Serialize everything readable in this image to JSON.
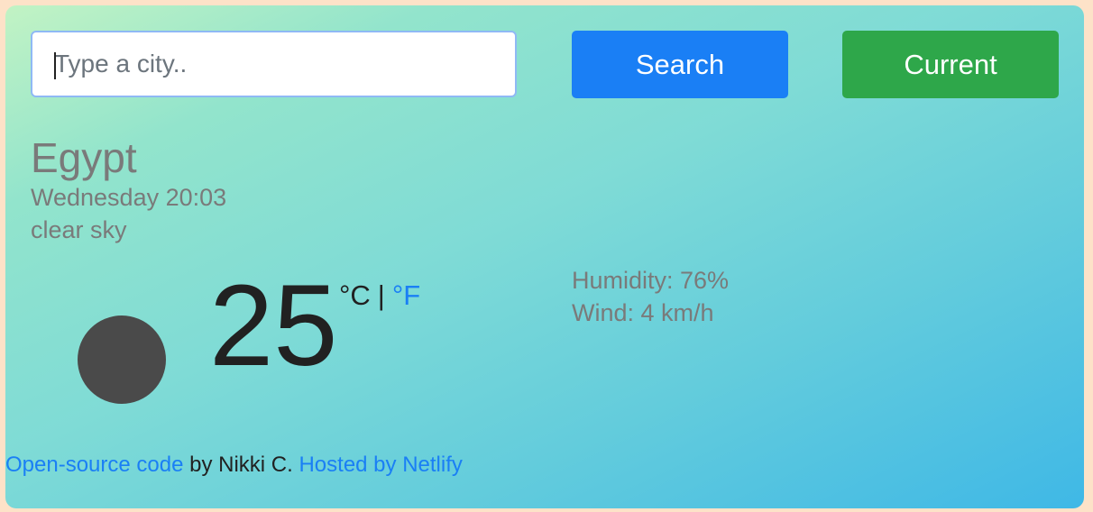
{
  "search": {
    "value": "",
    "placeholder": "Type a city..",
    "search_label": "Search",
    "current_label": "Current"
  },
  "weather": {
    "city": "Egypt",
    "datetime": "Wednesday 20:03",
    "description": "clear sky",
    "temperature": "25",
    "unit_c": "°C",
    "unit_separator": "|",
    "unit_f": "°F",
    "humidity": "Humidity: 76%",
    "wind": "Wind: 4 km/h",
    "icon": "weather-condition-icon"
  },
  "footer": {
    "source_link": "Open-source code",
    "author_text": " by Nikki C. ",
    "host_link": "Hosted by Netlify"
  },
  "colors": {
    "background": "#fde2c8",
    "search_button": "#1a7ff5",
    "current_button": "#2ea74a",
    "link": "#1a7ff5",
    "muted_text": "#7a7a7a"
  }
}
